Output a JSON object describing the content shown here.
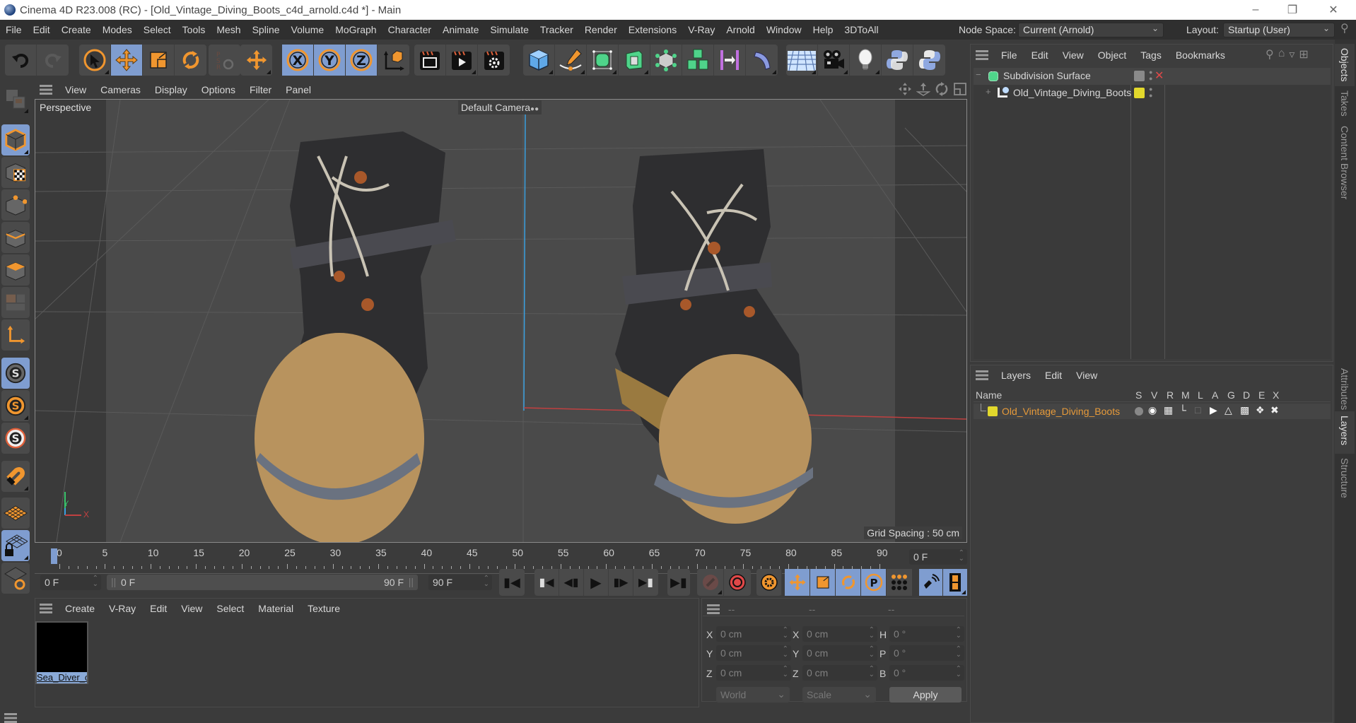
{
  "window": {
    "title": "Cinema 4D R23.008 (RC) - [Old_Vintage_Diving_Boots_c4d_arnold.c4d *] - Main",
    "controls": [
      "minimize",
      "restore",
      "close"
    ]
  },
  "menubar": {
    "items": [
      "File",
      "Edit",
      "Create",
      "Modes",
      "Select",
      "Tools",
      "Mesh",
      "Spline",
      "Volume",
      "MoGraph",
      "Character",
      "Animate",
      "Simulate",
      "Tracker",
      "Render",
      "Extensions",
      "V-Ray",
      "Arnold",
      "Window",
      "Help",
      "3DToAll"
    ],
    "node_space_label": "Node Space:",
    "node_space_value": "Current (Arnold)",
    "layout_label": "Layout:",
    "layout_value": "Startup (User)"
  },
  "toolbar": {
    "groups": [
      {
        "name": "history",
        "tools": [
          "undo-icon",
          "redo-icon"
        ]
      },
      {
        "name": "modes",
        "tools": [
          "select-icon",
          "move-icon",
          "scale-icon",
          "rotate-icon"
        ]
      },
      {
        "name": "psr",
        "tools": [
          "psr-reset-icon"
        ]
      },
      {
        "name": "transform",
        "tools": [
          "transform-icon"
        ]
      },
      {
        "name": "axis",
        "tools": [
          "x-axis-icon",
          "y-axis-icon",
          "z-axis-icon",
          "coordinate-system-icon"
        ]
      },
      {
        "name": "render",
        "tools": [
          "render-view-icon",
          "render-picture-viewer-icon",
          "render-settings-icon"
        ]
      },
      {
        "name": "create",
        "tools": [
          "cube-icon",
          "pen-icon",
          "subdivision-icon",
          "extrude-icon",
          "deformer-icon",
          "cloner-icon",
          "symmetry-icon",
          "bend-icon"
        ]
      },
      {
        "name": "scene",
        "tools": [
          "floor-icon",
          "camera-icon",
          "light-icon",
          "python-icon",
          "python-icon-2"
        ]
      }
    ]
  },
  "left_palette": {
    "tools": [
      "make-editable-icon",
      "model-mode-icon",
      "texture-mode-icon",
      "point-mode-icon",
      "edge-mode-icon",
      "polygon-mode-icon",
      "uv-mode-icon",
      "axis-mode-icon",
      "solo-off-icon",
      "solo-icon",
      "solo-hierarchy-icon",
      "snap-icon",
      "workplane-icon",
      "locked-workplane-icon",
      "workplane-align-icon"
    ]
  },
  "viewport": {
    "menu": [
      "View",
      "Cameras",
      "Display",
      "Options",
      "Filter",
      "Panel"
    ],
    "label": "Perspective",
    "camera": "Default Camera",
    "grid_spacing": "Grid Spacing : 50 cm",
    "axis_x": "X",
    "axis_y": "Y",
    "nav_icons": [
      "pan-icon",
      "dolly-icon",
      "orbit-icon",
      "maximize-icon"
    ]
  },
  "timeline": {
    "ticks": [
      "0",
      "5",
      "10",
      "15",
      "20",
      "25",
      "30",
      "35",
      "40",
      "45",
      "50",
      "55",
      "60",
      "65",
      "70",
      "75",
      "80",
      "85",
      "90"
    ],
    "current_frame_field": "0 F",
    "start_field": "0 F",
    "range_start": "0 F",
    "range_end": "90 F",
    "end_field": "90 F",
    "playhead_frame": 0
  },
  "playback": {
    "buttons": [
      "go-to-start-icon",
      "prev-key-icon",
      "prev-frame-icon",
      "play-icon",
      "next-frame-icon",
      "next-key-icon",
      "go-to-end-icon"
    ]
  },
  "materials": {
    "menu": [
      "Create",
      "V-Ray",
      "Edit",
      "View",
      "Select",
      "Material",
      "Texture"
    ],
    "items": [
      {
        "name": "Sea_Diver_c"
      }
    ]
  },
  "coordinates": {
    "headers": [
      "--",
      "--",
      "--"
    ],
    "rows": [
      {
        "l1": "X",
        "v1": "0 cm",
        "l2": "X",
        "v2": "0 cm",
        "l3": "H",
        "v3": "0 °"
      },
      {
        "l1": "Y",
        "v1": "0 cm",
        "l2": "Y",
        "v2": "0 cm",
        "l3": "P",
        "v3": "0 °"
      },
      {
        "l1": "Z",
        "v1": "0 cm",
        "l2": "Z",
        "v2": "0 cm",
        "l3": "B",
        "v3": "0 °"
      }
    ],
    "space_select": "World",
    "mode_select": "Scale",
    "apply": "Apply"
  },
  "objects_panel": {
    "menu": [
      "File",
      "Edit",
      "View",
      "Object",
      "Tags",
      "Bookmarks"
    ],
    "tree": [
      {
        "name": "Subdivision Surface",
        "expand": "−",
        "color": "#5fd08a"
      },
      {
        "name": "Old_Vintage_Diving_Boots",
        "expand": "+",
        "color": "#e2d82c"
      }
    ]
  },
  "layers_panel": {
    "menu": [
      "Layers",
      "Edit",
      "View"
    ],
    "columns": [
      "Name",
      "S",
      "V",
      "R",
      "M",
      "L",
      "A",
      "G",
      "D",
      "E",
      "X"
    ],
    "layers": [
      {
        "name": "Old_Vintage_Diving_Boots",
        "color": "#e2d82c"
      }
    ]
  },
  "side_tabs": {
    "top": [
      "Objects",
      "Takes",
      "Content Browser"
    ],
    "bottom": [
      "Attributes",
      "Layers",
      "Structure"
    ]
  },
  "colors": {
    "accent_orange": "#f0962f",
    "selected_blue": "#7f9dd0",
    "layer_name": "#e69a3a",
    "axis_x": "#d04545",
    "axis_y": "#38c16a",
    "axis_z": "#3aa0e0"
  }
}
